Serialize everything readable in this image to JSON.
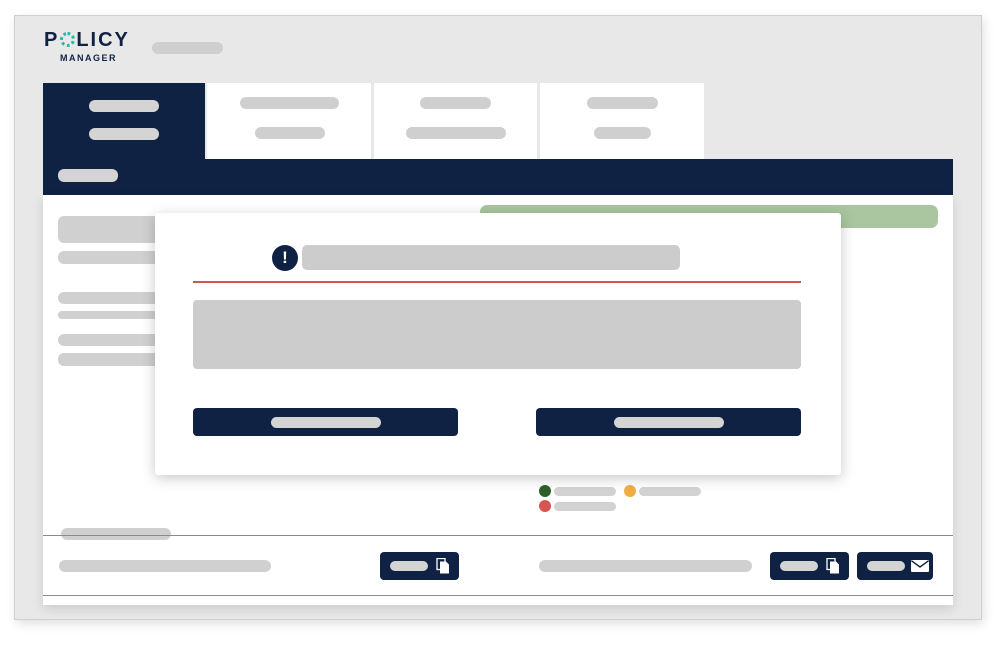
{
  "app": {
    "logo_word_left": "P",
    "logo_word_right": "LICY",
    "logo_sub": "MANAGER"
  },
  "colors": {
    "navy": "#0f2244",
    "teal_accent": "#2fb4a8",
    "success_banner": "#a9c6a0",
    "alert_rule": "#c85a4e",
    "legend_green": "#2f5e2b",
    "legend_orange": "#f0ad45",
    "legend_red": "#d9534f",
    "placeholder_gray": "#cccccc"
  },
  "modal": {
    "alert_glyph": "!",
    "icon": "exclamation-circle-icon"
  },
  "icons": {
    "copy": "document-copy-icon",
    "email": "envelope-icon"
  }
}
